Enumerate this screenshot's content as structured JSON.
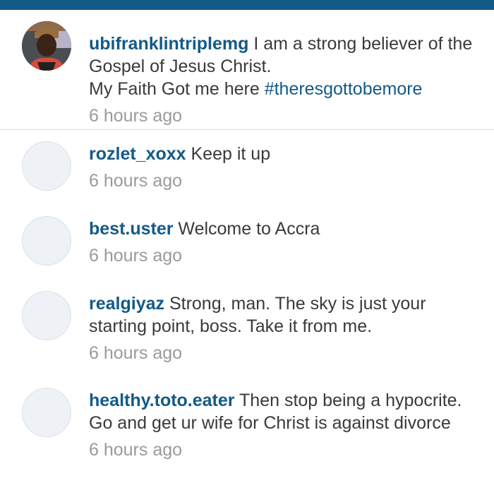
{
  "caption": {
    "username": "ubifranklintriplemg",
    "text_line1": " I am a strong believer of the Gospel of Jesus Christ.",
    "text_line2": "My Faith Got me here ",
    "hashtag": "#theresgottobemore",
    "time": "6 hours ago"
  },
  "comments": [
    {
      "username": "rozlet_xoxx",
      "text": " Keep it up",
      "time": "6 hours ago"
    },
    {
      "username": "best.uster",
      "text": " Welcome to Accra",
      "time": "6 hours ago"
    },
    {
      "username": "realgiyaz",
      "text": " Strong, man. The sky is just your starting point, boss. Take it from me.",
      "time": "6 hours ago"
    },
    {
      "username": "healthy.toto.eater",
      "text": " Then stop being a hypocrite. Go and get ur wife for Christ is against divorce",
      "time": "6 hours ago"
    }
  ],
  "colors": {
    "accent": "#135a86",
    "text": "#3a3a3a",
    "muted": "#9a9a9a"
  }
}
